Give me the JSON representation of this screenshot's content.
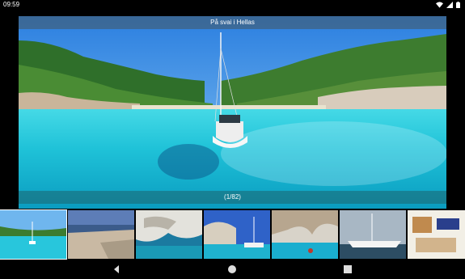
{
  "status_bar": {
    "time": "09:59",
    "icons": [
      "wifi-icon",
      "cell-signal-icon",
      "battery-icon"
    ]
  },
  "viewer": {
    "caption": "På svai i Hellas",
    "counter": "(1/82)"
  },
  "thumbnails": [
    {
      "name": "thumbnail-1-bay-sailboat",
      "selected": true
    },
    {
      "name": "thumbnail-2-harbor"
    },
    {
      "name": "thumbnail-3-white-cliffs"
    },
    {
      "name": "thumbnail-4-anchored-boats"
    },
    {
      "name": "thumbnail-5-rock-arch"
    },
    {
      "name": "thumbnail-6-sailboat"
    },
    {
      "name": "thumbnail-7-cabin-interior"
    }
  ],
  "navigation": {
    "buttons": [
      "back-icon",
      "home-icon",
      "recents-icon"
    ]
  },
  "colors": {
    "background": "#000000",
    "caption_bar": "#46555f",
    "water": "#1fc2d8"
  }
}
